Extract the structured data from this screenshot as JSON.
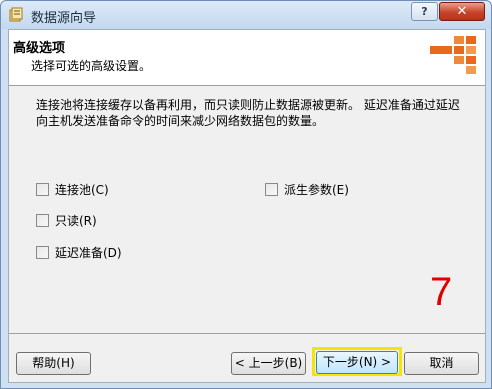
{
  "window": {
    "title": "数据源向导",
    "help_label": "?",
    "close_label": "✕"
  },
  "header": {
    "title": "高级选项",
    "subtitle": "选择可选的高级设置。"
  },
  "description": "连接池将连接缓存以备再利用，而只读则防止数据源被更新。 延迟准备通过延迟向主机发送准备命令的时间来减少网络数据包的数量。",
  "options": {
    "connection_pool": "连接池(C)",
    "read_only": "只读(R)",
    "delay_prepare": "延迟准备(D)",
    "derived_params": "派生参数(E)"
  },
  "annotation": "7",
  "buttons": {
    "help": "帮助(H)",
    "back": "< 上一步(B)",
    "next": "下一步(N) >",
    "cancel": "取消"
  },
  "colors": {
    "annotation": "#e00000",
    "highlight": "#f5e500",
    "logo_orange": "#e8681c"
  }
}
